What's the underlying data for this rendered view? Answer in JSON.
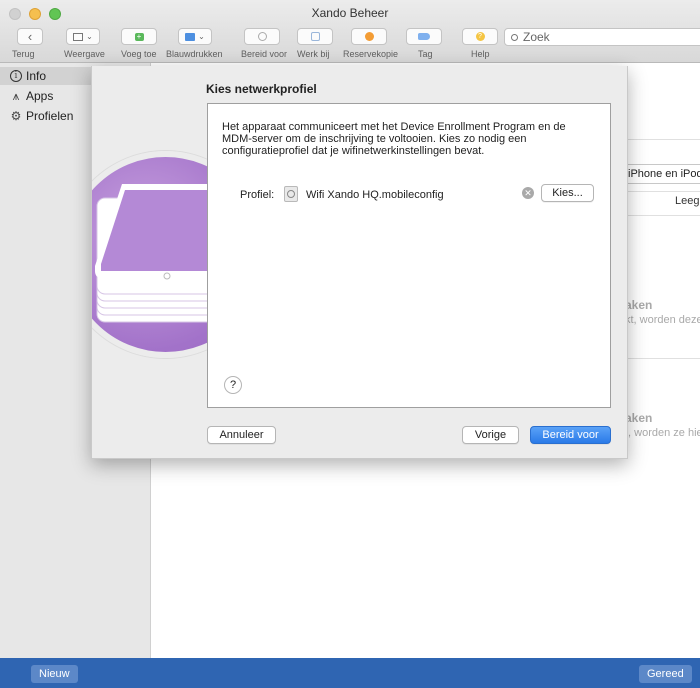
{
  "window": {
    "title": "Xando Beheer"
  },
  "toolbar": {
    "items": [
      {
        "label": "Terug",
        "icon": "chevron-left-icon"
      },
      {
        "label": "Weergave",
        "icon": "view-icon"
      },
      {
        "label": "Voeg toe",
        "icon": "plus-icon"
      },
      {
        "label": "Blauwdrukken",
        "icon": "blueprint-icon"
      },
      {
        "label": "Bereid voor",
        "icon": "prepare-icon"
      },
      {
        "label": "Werk bij",
        "icon": "update-icon"
      },
      {
        "label": "Reservekopie",
        "icon": "backup-icon"
      },
      {
        "label": "Tag",
        "icon": "tag-icon"
      },
      {
        "label": "Help",
        "icon": "help-icon"
      }
    ],
    "search_placeholder": "Zoek"
  },
  "sidebar": {
    "items": [
      {
        "label": "Info",
        "icon": "info-icon",
        "selected": true
      },
      {
        "label": "Apps",
        "icon": "apps-icon",
        "selected": false
      },
      {
        "label": "Profielen",
        "icon": "gear-icon",
        "selected": false
      }
    ]
  },
  "background": {
    "select_value": "iPhone en iPod touch",
    "leeg_label": "Leeg",
    "section1_title": "aken",
    "section1_text": "kt, worden deze",
    "section2_title": "aken",
    "section2_text": "t, worden ze hie"
  },
  "sheet": {
    "title": "Kies netwerkprofiel",
    "description": "Het apparaat communiceert met het Device Enrollment Program en de MDM-server om de inschrijving te voltooien. Kies zo nodig een configuratieprofiel dat je wifinetwerkinstellingen bevat.",
    "profile_label": "Profiel:",
    "profile_value": "Wifi Xando HQ.mobileconfig",
    "choose_button": "Kies...",
    "help_button": "?",
    "cancel_button": "Annuleer",
    "back_button": "Vorige",
    "prepare_button": "Bereid voor"
  },
  "bottombar": {
    "new_button": "Nieuw",
    "done_button": "Gereed"
  },
  "colors": {
    "accent": "#2a7ae8",
    "bottombar": "#2f65b2",
    "illustration": "#a272c9"
  }
}
